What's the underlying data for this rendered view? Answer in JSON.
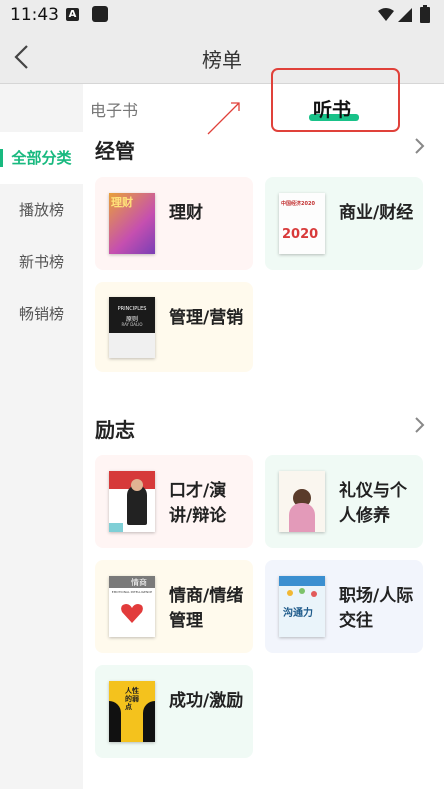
{
  "status_bar": {
    "time": "11:43",
    "notif_a": "A"
  },
  "app_bar": {
    "title": "榜单"
  },
  "tabs": {
    "ebook": "电子书",
    "audio": "听书"
  },
  "sidebar": {
    "items": [
      {
        "label": "全部分类",
        "active": true
      },
      {
        "label": "播放榜",
        "active": false
      },
      {
        "label": "新书榜",
        "active": false
      },
      {
        "label": "畅销榜",
        "active": false
      }
    ]
  },
  "sections": [
    {
      "title": "经管",
      "cards": [
        {
          "label": "理财",
          "color": "pink",
          "cover": "cover-finance"
        },
        {
          "label": "商业/财经",
          "color": "green",
          "cover": "cover-business"
        },
        {
          "label": "管理/营销",
          "color": "yellow",
          "cover": "cover-principles"
        }
      ]
    },
    {
      "title": "励志",
      "cards": [
        {
          "label": "口才/演讲/辩论",
          "color": "pink",
          "cover": "cover-speech"
        },
        {
          "label": "礼仪与个人修养",
          "color": "green",
          "cover": "cover-etiquette"
        },
        {
          "label": "情商/情绪管理",
          "color": "yellow",
          "cover": "cover-eq"
        },
        {
          "label": "职场/人际交往",
          "color": "blue",
          "cover": "cover-career"
        },
        {
          "label": "成功/激励",
          "color": "green",
          "cover": "cover-success"
        }
      ]
    }
  ],
  "book_cover_text": {
    "finance": "理财",
    "business": "中国经济2020",
    "business_year": "2020",
    "principles": "PRINCIPLES",
    "principles_cn": "原则",
    "principles_author": "RAY DALIO",
    "eq": "情商",
    "eq_en": "EMOTIONAL INTELLIGENCE",
    "career": "沟通力",
    "success": "人性的弱点"
  },
  "colors": {
    "accent": "#18b97f",
    "highlight_box": "#e0413a"
  }
}
